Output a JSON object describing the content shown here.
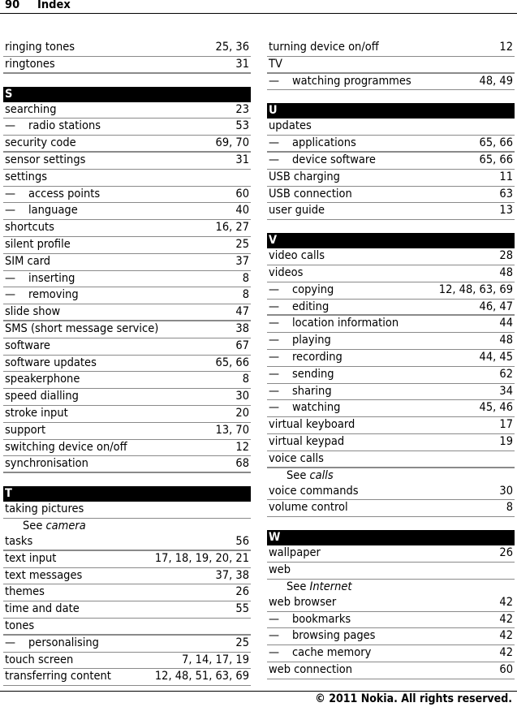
{
  "header": {
    "page_number": "90",
    "title": "Index"
  },
  "footer": {
    "copyright": "© 2011 Nokia. All rights reserved."
  },
  "columns": [
    {
      "blocks": [
        {
          "type": "row",
          "term": "ringing tones",
          "pages": "25, 36"
        },
        {
          "type": "row",
          "term": "ringtones",
          "pages": "31",
          "thick": true
        },
        {
          "type": "letter",
          "label": "S"
        },
        {
          "type": "row",
          "term": "searching",
          "pages": "23"
        },
        {
          "type": "row",
          "term": "radio stations",
          "pages": "53",
          "sub": true
        },
        {
          "type": "row",
          "term": "security code",
          "pages": "69, 70",
          "thick": true
        },
        {
          "type": "row",
          "term": "sensor settings",
          "pages": "31"
        },
        {
          "type": "row",
          "term": "settings",
          "pages": ""
        },
        {
          "type": "row",
          "term": "access points",
          "pages": "60",
          "sub": true
        },
        {
          "type": "row",
          "term": "language",
          "pages": "40",
          "sub": true
        },
        {
          "type": "row",
          "term": "shortcuts",
          "pages": "16, 27"
        },
        {
          "type": "row",
          "term": "silent profile",
          "pages": "25"
        },
        {
          "type": "row",
          "term": "SIM card",
          "pages": "37"
        },
        {
          "type": "row",
          "term": "inserting",
          "pages": "8",
          "sub": true
        },
        {
          "type": "row",
          "term": "removing",
          "pages": "8",
          "sub": true
        },
        {
          "type": "row",
          "term": "slide show",
          "pages": "47",
          "thick": true
        },
        {
          "type": "row",
          "term": "SMS (short message service)",
          "pages": "38"
        },
        {
          "type": "row",
          "term": "software",
          "pages": "67"
        },
        {
          "type": "row",
          "term": "software updates",
          "pages": "65, 66"
        },
        {
          "type": "row",
          "term": "speakerphone",
          "pages": "8"
        },
        {
          "type": "row",
          "term": "speed dialling",
          "pages": "30"
        },
        {
          "type": "row",
          "term": "stroke input",
          "pages": "20"
        },
        {
          "type": "row",
          "term": "support",
          "pages": "13, 70"
        },
        {
          "type": "row",
          "term": "switching device on/off",
          "pages": "12"
        },
        {
          "type": "row",
          "term": "synchronisation",
          "pages": "68",
          "thick": true
        },
        {
          "type": "letter",
          "label": "T"
        },
        {
          "type": "row",
          "term": "taking pictures",
          "pages": ""
        },
        {
          "type": "see",
          "prefix": "See",
          "ref": "camera"
        },
        {
          "type": "row",
          "term": "tasks",
          "pages": "56",
          "thick": true
        },
        {
          "type": "row",
          "term": "text input",
          "pages": "17, 18, 19, 20, 21"
        },
        {
          "type": "row",
          "term": "text messages",
          "pages": "37, 38"
        },
        {
          "type": "row",
          "term": "themes",
          "pages": "26"
        },
        {
          "type": "row",
          "term": "time and date",
          "pages": "55"
        },
        {
          "type": "row",
          "term": "tones",
          "pages": "",
          "thick": true
        },
        {
          "type": "row",
          "term": "personalising",
          "pages": "25",
          "sub": true
        },
        {
          "type": "row",
          "term": "touch screen",
          "pages": "7, 14, 17, 19"
        },
        {
          "type": "row",
          "term": "transferring content",
          "pages": "12, 48, 51, 63, 69"
        }
      ]
    },
    {
      "blocks": [
        {
          "type": "row",
          "term": "turning device on/off",
          "pages": "12"
        },
        {
          "type": "row",
          "term": "TV",
          "pages": "",
          "thick": true
        },
        {
          "type": "row",
          "term": "watching programmes",
          "pages": "48, 49",
          "sub": true
        },
        {
          "type": "letter",
          "label": "U"
        },
        {
          "type": "row",
          "term": "updates",
          "pages": ""
        },
        {
          "type": "row",
          "term": "applications",
          "pages": "65, 66",
          "sub": true,
          "thick": true
        },
        {
          "type": "row",
          "term": "device software",
          "pages": "65, 66",
          "sub": true
        },
        {
          "type": "row",
          "term": "USB charging",
          "pages": "11"
        },
        {
          "type": "row",
          "term": "USB connection",
          "pages": "63"
        },
        {
          "type": "row",
          "term": "user guide",
          "pages": "13"
        },
        {
          "type": "letter",
          "label": "V"
        },
        {
          "type": "row",
          "term": "video calls",
          "pages": "28"
        },
        {
          "type": "row",
          "term": "videos",
          "pages": "48"
        },
        {
          "type": "row",
          "term": "copying",
          "pages": "12, 48, 63, 69",
          "sub": true
        },
        {
          "type": "row",
          "term": "editing",
          "pages": "46, 47",
          "sub": true,
          "thick": true
        },
        {
          "type": "row",
          "term": "location information",
          "pages": "44",
          "sub": true
        },
        {
          "type": "row",
          "term": "playing",
          "pages": "48",
          "sub": true
        },
        {
          "type": "row",
          "term": "recording",
          "pages": "44, 45",
          "sub": true
        },
        {
          "type": "row",
          "term": "sending",
          "pages": "62",
          "sub": true
        },
        {
          "type": "row",
          "term": "sharing",
          "pages": "34",
          "sub": true
        },
        {
          "type": "row",
          "term": "watching",
          "pages": "45, 46",
          "sub": true
        },
        {
          "type": "row",
          "term": "virtual keyboard",
          "pages": "17"
        },
        {
          "type": "row",
          "term": "virtual keypad",
          "pages": "19"
        },
        {
          "type": "row",
          "term": "voice calls",
          "pages": "",
          "thick": true
        },
        {
          "type": "see",
          "prefix": "See",
          "ref": "calls"
        },
        {
          "type": "row",
          "term": "voice commands",
          "pages": "30"
        },
        {
          "type": "row",
          "term": "volume control",
          "pages": "8"
        },
        {
          "type": "letter",
          "label": "W"
        },
        {
          "type": "row",
          "term": "wallpaper",
          "pages": "26"
        },
        {
          "type": "row",
          "term": "web",
          "pages": ""
        },
        {
          "type": "see",
          "prefix": "See",
          "ref": "Internet"
        },
        {
          "type": "row",
          "term": "web browser",
          "pages": "42"
        },
        {
          "type": "row",
          "term": "bookmarks",
          "pages": "42",
          "sub": true
        },
        {
          "type": "row",
          "term": "browsing pages",
          "pages": "42",
          "sub": true
        },
        {
          "type": "row",
          "term": "cache memory",
          "pages": "42",
          "sub": true
        },
        {
          "type": "row",
          "term": "web connection",
          "pages": "60"
        }
      ]
    }
  ],
  "sub_dash": "—"
}
